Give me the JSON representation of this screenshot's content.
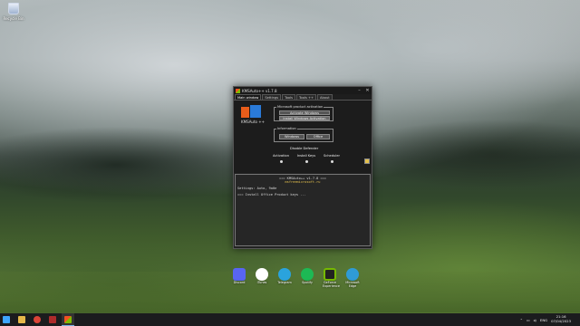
{
  "desktop": {
    "icons": [
      {
        "label": "Recycle Bin",
        "icon": "recycle-bin-icon"
      }
    ]
  },
  "window": {
    "title": "KMSAuto++ v1.7.8",
    "tabs": [
      "Main window",
      "Settings",
      "Tools",
      "Tools ++",
      "About"
    ],
    "logo_text": "KMSAuto ++",
    "activation_group": {
      "label": "Microsoft product activation",
      "activate_button": "Activate Windows",
      "info_button": "Install Windows Activation"
    },
    "info_group": {
      "label": "Information",
      "windows_button": "Windows",
      "office_button": "Office"
    },
    "disable_defender": "Disable Defender",
    "toggles": [
      "Activation",
      "Install Keys",
      "Scheduler"
    ],
    "console": {
      "header": "=== KMSAuto++ v1.7.8 ===",
      "site": "msfreemicrosoft.ru",
      "settings": "Settings: Auto, 9a0e",
      "line": "=== Install Office Product keys ..."
    }
  },
  "dock": [
    {
      "label": "Discord",
      "color": "#5865f2"
    },
    {
      "label": "iTunes",
      "color": "#ffffff"
    },
    {
      "label": "Telegram",
      "color": "#2aa3dd"
    },
    {
      "label": "Spotify",
      "color": "#1db954"
    },
    {
      "label": "GeForce Experience",
      "color": "#222222"
    },
    {
      "label": "Microsoft Edge",
      "color": "#2f9bd6"
    }
  ],
  "taskbar": {
    "items": [
      "start",
      "file-explorer",
      "chrome",
      "edge",
      "kmsauto"
    ],
    "tray": {
      "lang": "ENG",
      "time": "21:16",
      "date": "07/04/2023"
    }
  }
}
